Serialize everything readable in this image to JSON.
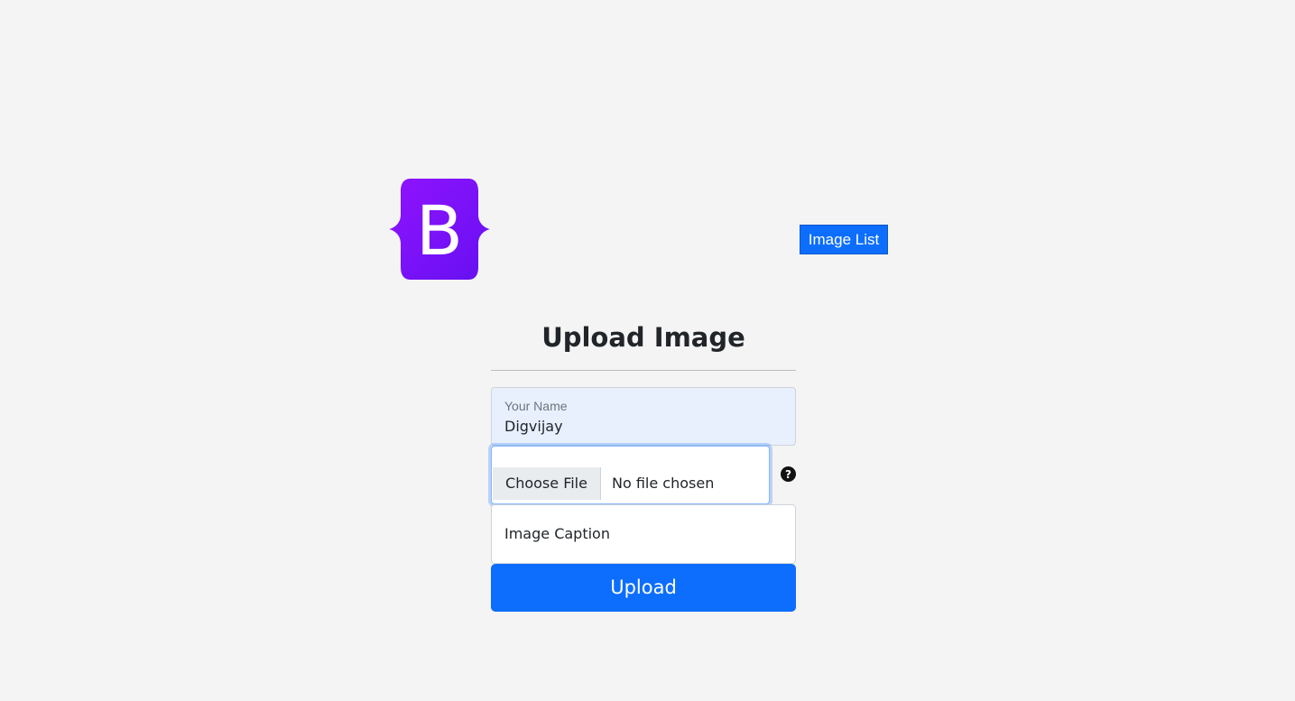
{
  "header": {
    "logo_icon": "bootstrap-logo-icon",
    "logo_letter": "B",
    "image_list_label": "Image List"
  },
  "form": {
    "title": "Upload Image",
    "name_field": {
      "label": "Your Name",
      "value": "Digvijay"
    },
    "file_field": {
      "button_label": "Choose File",
      "status": "No file chosen",
      "help_icon": "question-circle-icon"
    },
    "caption_field": {
      "placeholder": "Image Caption"
    },
    "submit_label": "Upload"
  },
  "colors": {
    "background": "#f4f4f4",
    "primary": "#0d6efd",
    "logo_gradient_start": "#9013fe",
    "logo_gradient_end": "#6610f2",
    "autofill": "#e8f0fe"
  }
}
